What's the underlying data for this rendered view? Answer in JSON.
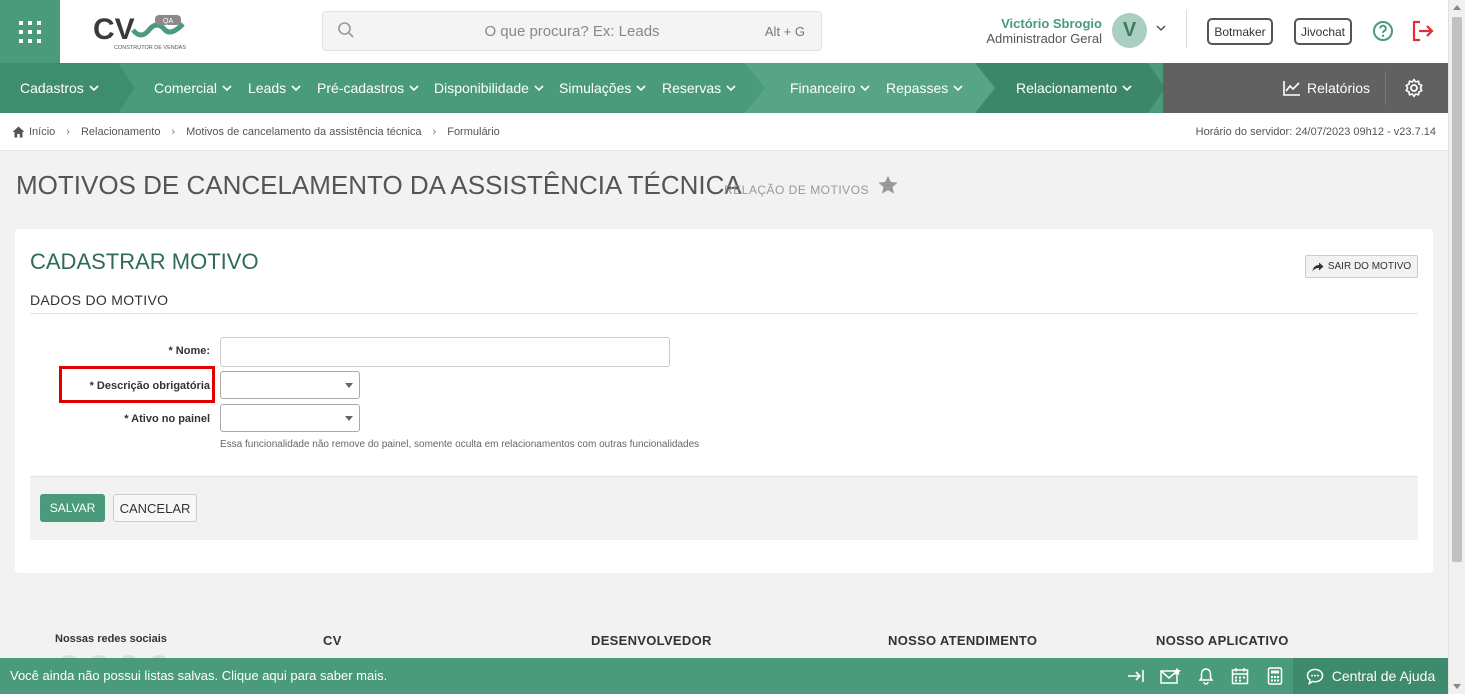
{
  "colors": {
    "brand": "#4a9a7c",
    "brand_dark": "#2e6b58",
    "highlight": "#e00000",
    "nav_gray": "#616161"
  },
  "header": {
    "logo_text": "CV",
    "logo_badge": "QA",
    "logo_tagline": "CONSTRUTOR DE VENDAS",
    "search_placeholder": "O que procura? Ex: Leads",
    "search_shortcut": "Alt + G",
    "user_name": "Victório Sbrogio",
    "user_role": "Administrador Geral",
    "avatar_initial": "V",
    "botmaker_label": "Botmaker",
    "jivochat_label": "Jivochat",
    "icons": [
      "apps-grid-icon",
      "search-icon",
      "chevron-down-icon",
      "help-icon",
      "logout-icon"
    ]
  },
  "nav": {
    "items": [
      {
        "label": "Cadastros"
      },
      {
        "label": "Comercial"
      },
      {
        "label": "Leads"
      },
      {
        "label": "Pré-cadastros"
      },
      {
        "label": "Disponibilidade"
      },
      {
        "label": "Simulações"
      },
      {
        "label": "Reservas"
      },
      {
        "label": "Financeiro"
      },
      {
        "label": "Repasses"
      },
      {
        "label": "Relacionamento"
      }
    ],
    "reports_label": "Relatórios"
  },
  "breadcrumb": {
    "items": [
      "Início",
      "Relacionamento",
      "Motivos de cancelamento da assistência técnica",
      "Formulário"
    ],
    "server_time": "Horário do servidor: 24/07/2023 09h12 - v23.7.14"
  },
  "page": {
    "title": "MOTIVOS DE CANCELAMENTO DA ASSISTÊNCIA TÉCNICA",
    "subtitle": "RELAÇÃO DE MOTIVOS"
  },
  "form": {
    "card_title": "CADASTRAR MOTIVO",
    "exit_label": "SAIR DO MOTIVO",
    "section_title": "DADOS DO MOTIVO",
    "name_label": "* Nome:",
    "name_value": "",
    "desc_label": "* Descrição obrigatória",
    "desc_value": "",
    "active_label": "* Ativo no painel",
    "active_value": "",
    "active_hint": "Essa funcionalidade não remove do painel, somente oculta em relacionamentos com outras funcionalidades",
    "save_label": "SALVAR",
    "cancel_label": "CANCELAR"
  },
  "footer": {
    "social_title": "Nossas redes sociais",
    "col_cv": "CV",
    "col_dev": "DESENVOLVEDOR",
    "col_support": "NOSSO ATENDIMENTO",
    "col_app": "NOSSO APLICATIVO",
    "bottom_message": "Você ainda não possui listas salvas. Clique aqui para saber mais.",
    "help_center_label": "Central de Ajuda"
  }
}
